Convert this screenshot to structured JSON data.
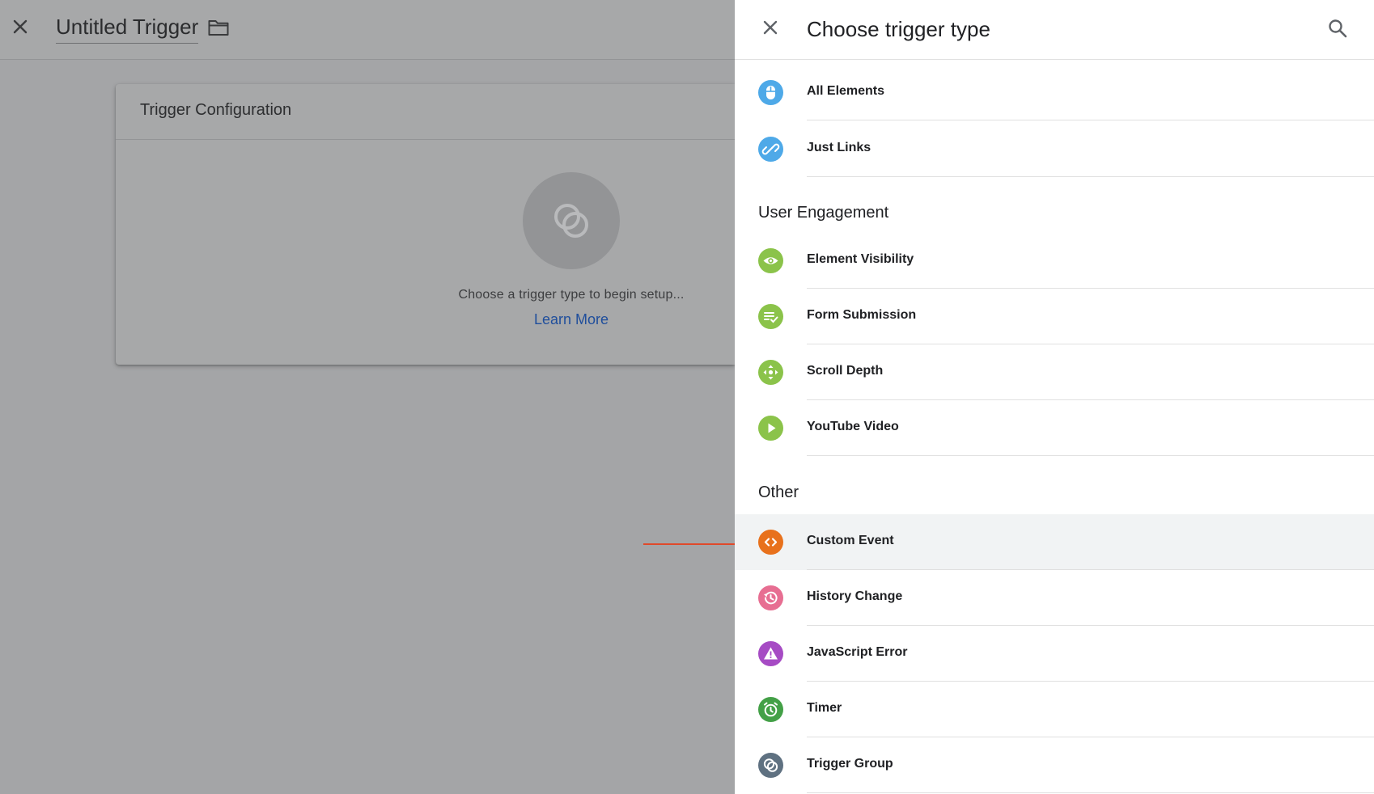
{
  "editor": {
    "trigger_name": "Untitled Trigger",
    "config_title": "Trigger Configuration",
    "config_hint": "Choose a trigger type to begin setup...",
    "learn_more": "Learn More"
  },
  "panel": {
    "title": "Choose trigger type",
    "groups": [
      {
        "title": "",
        "items": [
          {
            "label": "All Elements",
            "icon": "mouse-icon",
            "color": "#4ea9e8"
          },
          {
            "label": "Just Links",
            "icon": "link-icon",
            "color": "#4ea9e8"
          }
        ]
      },
      {
        "title": "User Engagement",
        "items": [
          {
            "label": "Element Visibility",
            "icon": "eye-icon",
            "color": "#8bc34a"
          },
          {
            "label": "Form Submission",
            "icon": "form-check-icon",
            "color": "#8bc34a"
          },
          {
            "label": "Scroll Depth",
            "icon": "scroll-arrows-icon",
            "color": "#8bc34a"
          },
          {
            "label": "YouTube Video",
            "icon": "play-icon",
            "color": "#8bc34a"
          }
        ]
      },
      {
        "title": "Other",
        "items": [
          {
            "label": "Custom Event",
            "icon": "code-icon",
            "color": "#e8711c",
            "highlighted": true
          },
          {
            "label": "History Change",
            "icon": "history-icon",
            "color": "#e76e92"
          },
          {
            "label": "JavaScript Error",
            "icon": "warning-icon",
            "color": "#a64bc4"
          },
          {
            "label": "Timer",
            "icon": "alarm-clock-icon",
            "color": "#43a047"
          },
          {
            "label": "Trigger Group",
            "icon": "trigger-group-icon",
            "color": "#5f7181"
          }
        ]
      }
    ]
  },
  "colors": {
    "overlay": "#a4a5a7",
    "link": "#1f4e9c",
    "arrow": "#e0492a"
  }
}
